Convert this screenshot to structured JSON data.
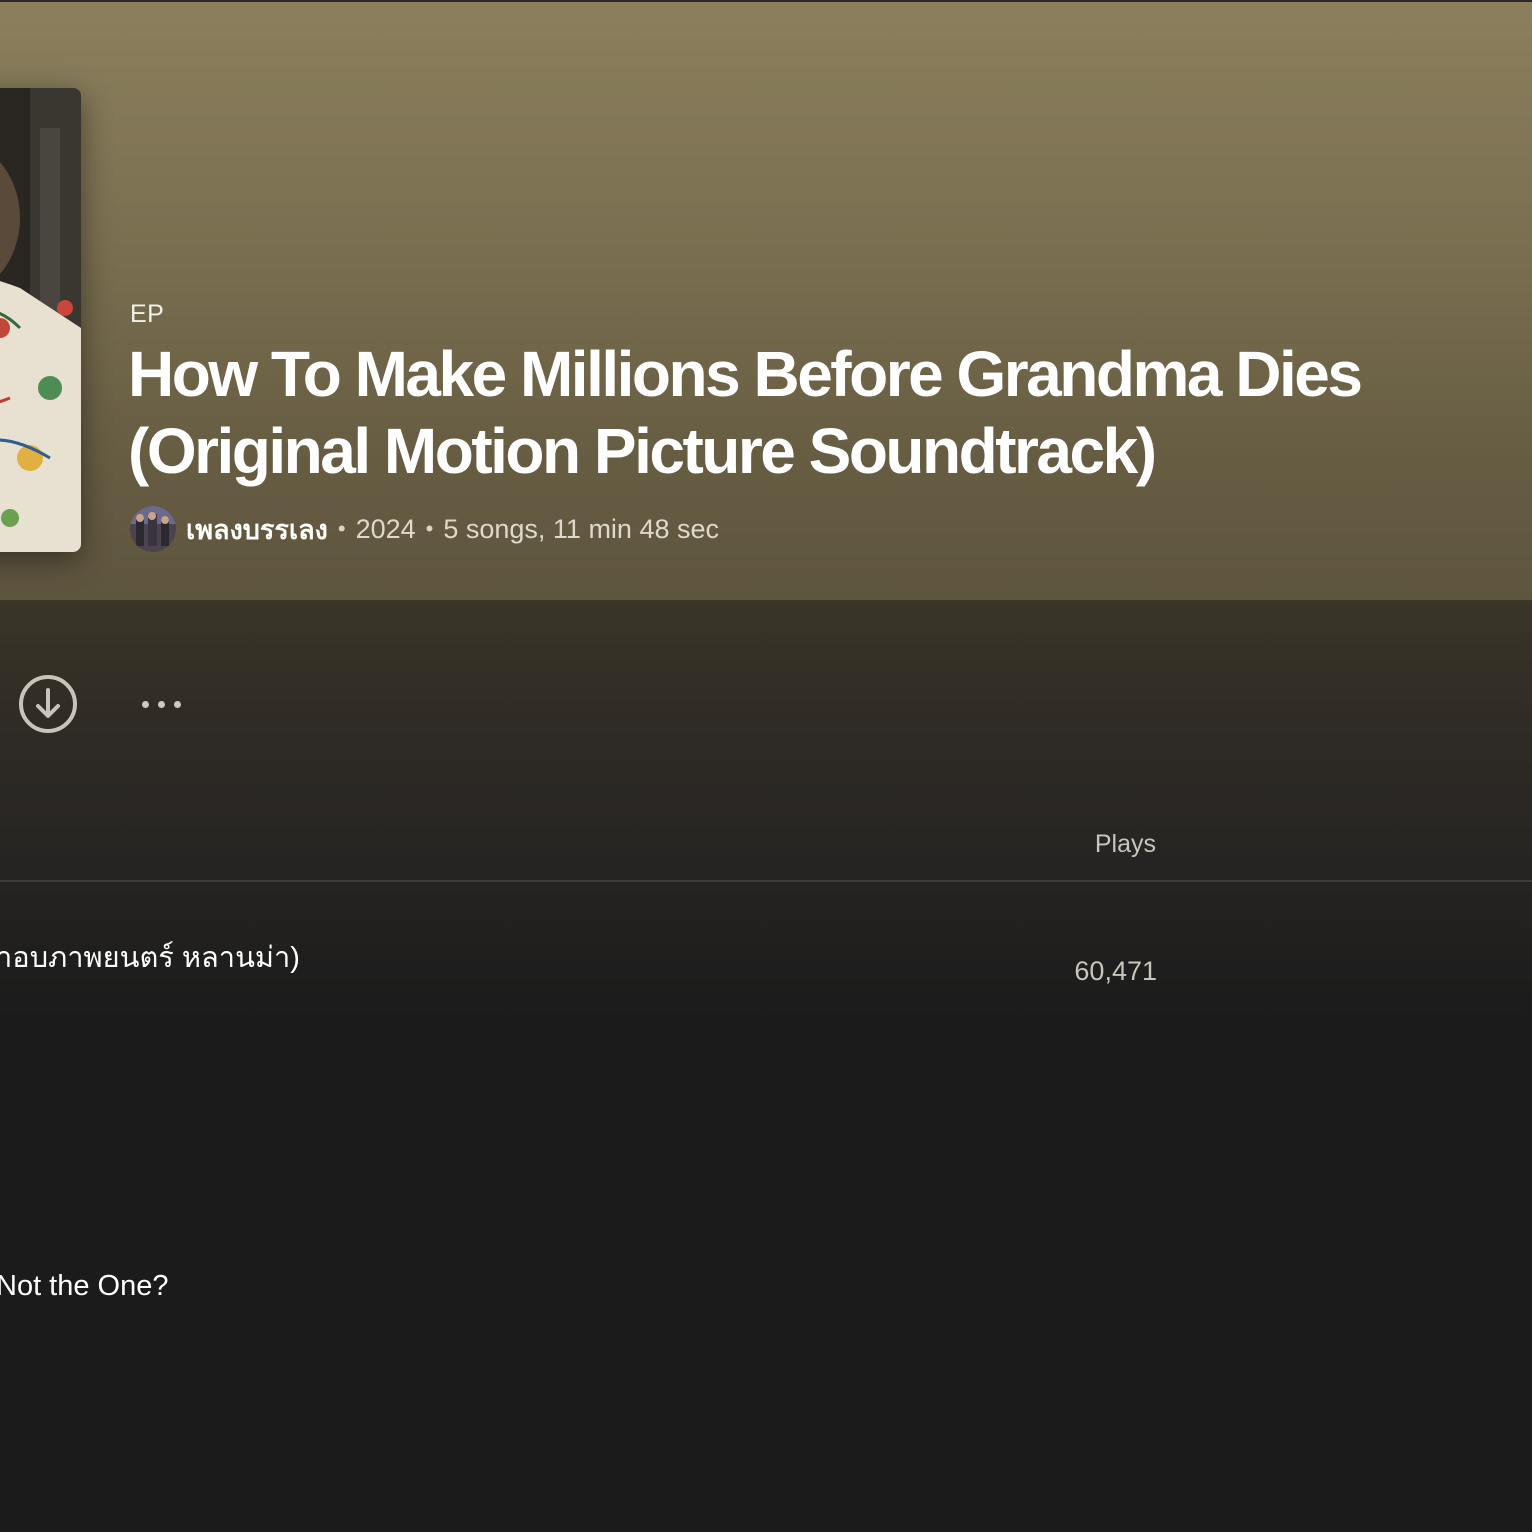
{
  "album": {
    "type_label": "EP",
    "title": "How To Make Millions Before Grandma Dies (Original Motion Picture Soundtrack)",
    "artist": "เพลงบรรเลง",
    "year": "2024",
    "summary": "5 songs, 11 min 48 sec",
    "separator": "•"
  },
  "actions": {
    "download_icon": "download-circle-icon",
    "more_icon": "more-options-icon"
  },
  "table": {
    "columns": {
      "plays": "Plays"
    },
    "rows": [
      {
        "title": "าอบภาพยนตร์ หลานม่า)",
        "plays": "60,471"
      },
      {
        "title": "Not the One?",
        "plays": ""
      }
    ]
  },
  "colors": {
    "header_top": "#8b7f5d",
    "header_bottom": "#5e553e",
    "background": "#1b1b1b",
    "muted_text": "#c9c5bc"
  }
}
